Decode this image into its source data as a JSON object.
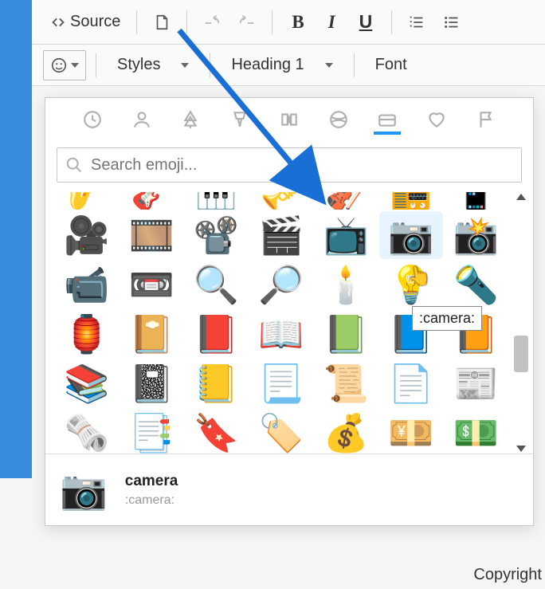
{
  "toolbar": {
    "source_label": "Source",
    "styles_label": "Styles",
    "heading_label": "Heading 1",
    "font_label": "Font"
  },
  "panel": {
    "search_placeholder": "Search emoji...",
    "categories": [
      "recent",
      "people",
      "nature",
      "food",
      "travel",
      "activity",
      "objects",
      "symbols",
      "flags"
    ],
    "active_category": "objects"
  },
  "emojis": {
    "partial": [
      "🎷",
      "🎸",
      "🎹",
      "🎺",
      "🎻",
      "📻",
      "📱"
    ],
    "rows": [
      [
        "🎥",
        "🎞️",
        "📽️",
        "🎬",
        "📺",
        "📷",
        "📸"
      ],
      [
        "📹",
        "📼",
        "🔍",
        "🔎",
        "🕯️",
        "💡",
        "🔦"
      ],
      [
        "🏮",
        "📔",
        "📕",
        "📖",
        "📗",
        "📘",
        "📙"
      ],
      [
        "📚",
        "📓",
        "📒",
        "📃",
        "📜",
        "📄",
        "📰"
      ],
      [
        "🗞️",
        "📑",
        "🔖",
        "🏷️",
        "💰",
        "💴",
        "💵"
      ]
    ]
  },
  "hover": {
    "name": "camera",
    "code": ":camera:",
    "glyph": "📷"
  },
  "page": {
    "copyright_fragment": "Copyright"
  }
}
